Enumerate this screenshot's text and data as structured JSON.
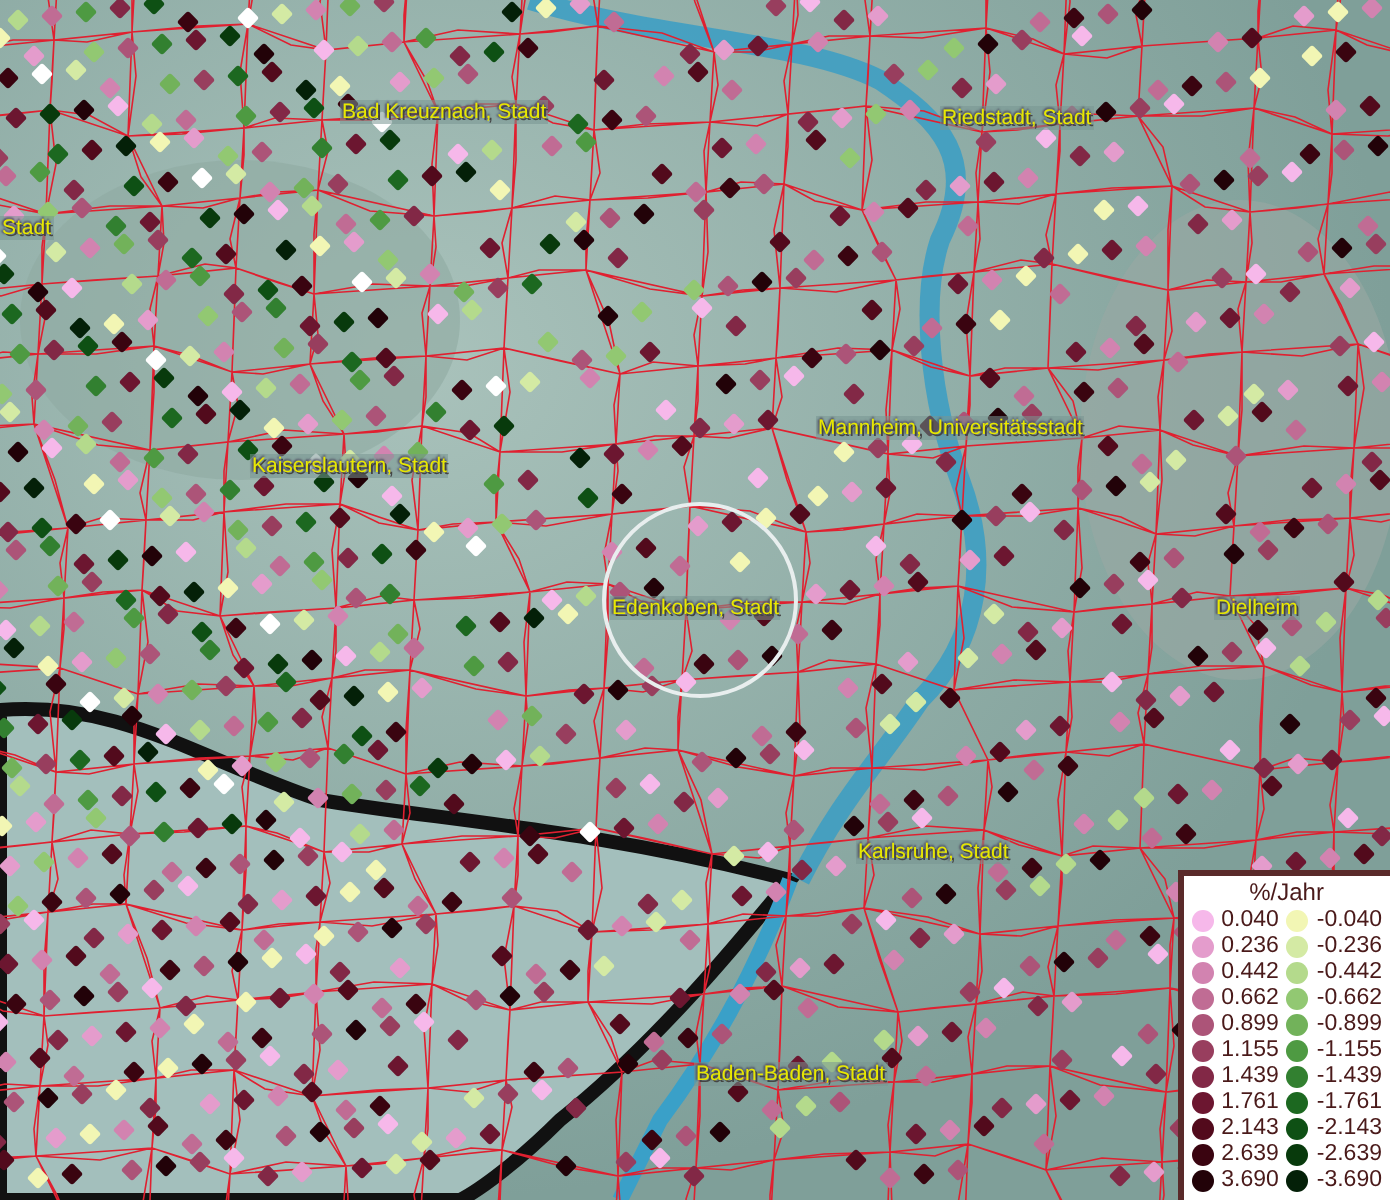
{
  "map": {
    "places": [
      {
        "name": "Bad Kreuznach, Stadt"
      },
      {
        "name": "Riedstadt, Stadt"
      },
      {
        "name": "Stadt"
      },
      {
        "name": "Mannheim, Universitätsstadt"
      },
      {
        "name": "Kaiserslautern, Stadt"
      },
      {
        "name": "Edenkoben, Stadt"
      },
      {
        "name": "Dielheim"
      },
      {
        "name": "Karlsruhe, Stadt"
      },
      {
        "name": "Baden-Baden, Stadt"
      }
    ]
  },
  "legend": {
    "title": "%/Jahr",
    "positive": [
      {
        "value": "0.040",
        "color": "#f6b8ea"
      },
      {
        "value": "0.236",
        "color": "#e49ccc"
      },
      {
        "value": "0.442",
        "color": "#d283b0"
      },
      {
        "value": "0.662",
        "color": "#c06c94"
      },
      {
        "value": "0.899",
        "color": "#ac5478"
      },
      {
        "value": "1.155",
        "color": "#983e5e"
      },
      {
        "value": "1.439",
        "color": "#822846"
      },
      {
        "value": "1.761",
        "color": "#6c1630"
      },
      {
        "value": "2.143",
        "color": "#520a1c"
      },
      {
        "value": "2.639",
        "color": "#3a0410"
      },
      {
        "value": "3.690",
        "color": "#220208"
      }
    ],
    "negative": [
      {
        "value": "-0.040",
        "color": "#f2f6b4"
      },
      {
        "value": "-0.236",
        "color": "#d4eaa4"
      },
      {
        "value": "-0.442",
        "color": "#b4da8c"
      },
      {
        "value": "-0.662",
        "color": "#92c872"
      },
      {
        "value": "-0.899",
        "color": "#72b25a"
      },
      {
        "value": "-1.155",
        "color": "#4e9a42"
      },
      {
        "value": "-1.439",
        "color": "#328030"
      },
      {
        "value": "-1.761",
        "color": "#1c6820"
      },
      {
        "value": "-2.143",
        "color": "#0e5014"
      },
      {
        "value": "-2.639",
        "color": "#083a0c"
      },
      {
        "value": "-3.690",
        "color": "#042008"
      }
    ]
  }
}
